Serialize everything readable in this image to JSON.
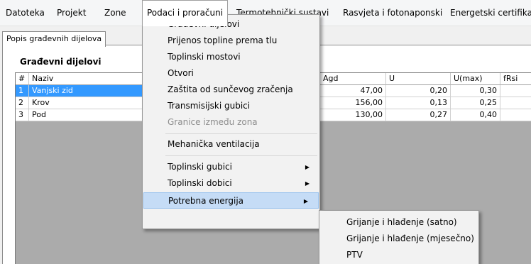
{
  "menubar": {
    "items": [
      "Datoteka",
      "Projekt",
      "Zone",
      "Podaci i proračuni",
      "Termotehnički sustavi",
      "Rasvjeta i fotonaponski",
      "Energetski certifika"
    ]
  },
  "tabs": [
    "Popis građevnih dijelova"
  ],
  "section_title": "Građevni dijelovi",
  "table": {
    "columns": [
      "#",
      "Naziv",
      "Agd",
      "U",
      "U(max)",
      "fRsi"
    ],
    "rows": [
      {
        "num": "1",
        "name": "Vanjski zid",
        "agd": "47,00",
        "u": "0,20",
        "umax": "0,30",
        "frsi": ""
      },
      {
        "num": "2",
        "name": "Krov",
        "agd": "156,00",
        "u": "0,13",
        "umax": "0,25",
        "frsi": ""
      },
      {
        "num": "3",
        "name": "Pod",
        "agd": "130,00",
        "u": "0,27",
        "umax": "0,40",
        "frsi": ""
      }
    ]
  },
  "dropdown": {
    "items": [
      {
        "label": "Građevni dijelovi"
      },
      {
        "label": "Prijenos topline prema tlu"
      },
      {
        "label": "Toplinski mostovi"
      },
      {
        "label": "Otvori"
      },
      {
        "label": "Zaštita od sunčevog zračenja"
      },
      {
        "label": "Transmisijski gubici"
      },
      {
        "label": "Granice između zona",
        "disabled": true
      },
      {
        "label": "Mehanička ventilacija"
      },
      {
        "label": "Toplinski gubici",
        "submenu": true
      },
      {
        "label": "Toplinski dobici",
        "submenu": true
      },
      {
        "label": "Potrebna energija",
        "submenu": true,
        "highlighted": true
      }
    ],
    "arrow_glyph": "▶"
  },
  "submenu": {
    "items": [
      "Grijanje i hlađenje (satno)",
      "Grijanje i hlađenje (mjesečno)",
      "PTV"
    ]
  },
  "colors": {
    "selection": "#3399ff",
    "menu_highlight": "#c5dcf6",
    "menu_background": "#f2f2f2"
  }
}
